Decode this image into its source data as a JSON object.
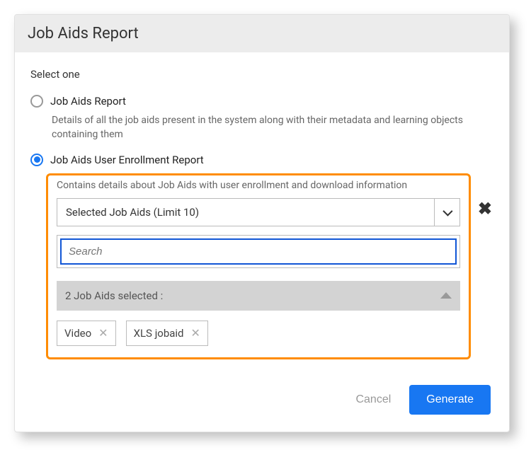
{
  "header": {
    "title": "Job Aids Report"
  },
  "body": {
    "select_label": "Select one",
    "options": [
      {
        "label": "Job Aids Report",
        "desc": "Details of all the job aids present in the system along with their metadata and learning objects containing them",
        "selected": false
      },
      {
        "label": "Job Aids User Enrollment Report",
        "desc": "Contains details about Job Aids with user enrollment and download information",
        "selected": true
      }
    ],
    "dropdown_label": "Selected Job Aids (Limit 10)",
    "search_placeholder": "Search",
    "selected_count_label": "2 Job Aids selected :",
    "chips": [
      "Video",
      "XLS jobaid"
    ]
  },
  "footer": {
    "cancel": "Cancel",
    "generate": "Generate"
  }
}
